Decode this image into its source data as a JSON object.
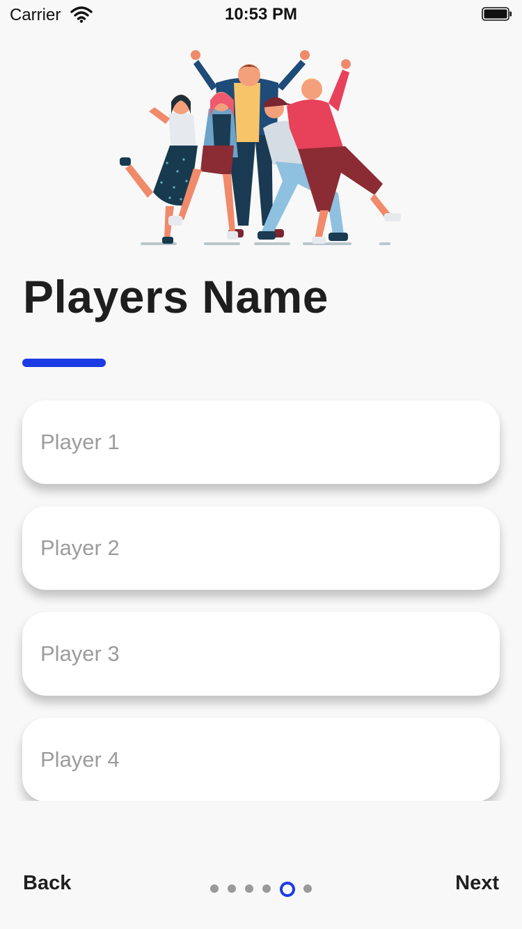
{
  "status_bar": {
    "carrier": "Carrier",
    "time": "10:53 PM"
  },
  "hero": {
    "illustration": "group-of-friends-cheering"
  },
  "page": {
    "title": "Players Name",
    "accent_color": "#1b3be4"
  },
  "players": [
    {
      "placeholder": "Player 1",
      "value": ""
    },
    {
      "placeholder": "Player 2",
      "value": ""
    },
    {
      "placeholder": "Player 3",
      "value": ""
    },
    {
      "placeholder": "Player 4",
      "value": ""
    }
  ],
  "nav": {
    "back_label": "Back",
    "next_label": "Next",
    "page_count": 6,
    "current_page": 5
  },
  "icons": {
    "wifi": "wifi-icon",
    "battery": "battery-icon"
  }
}
